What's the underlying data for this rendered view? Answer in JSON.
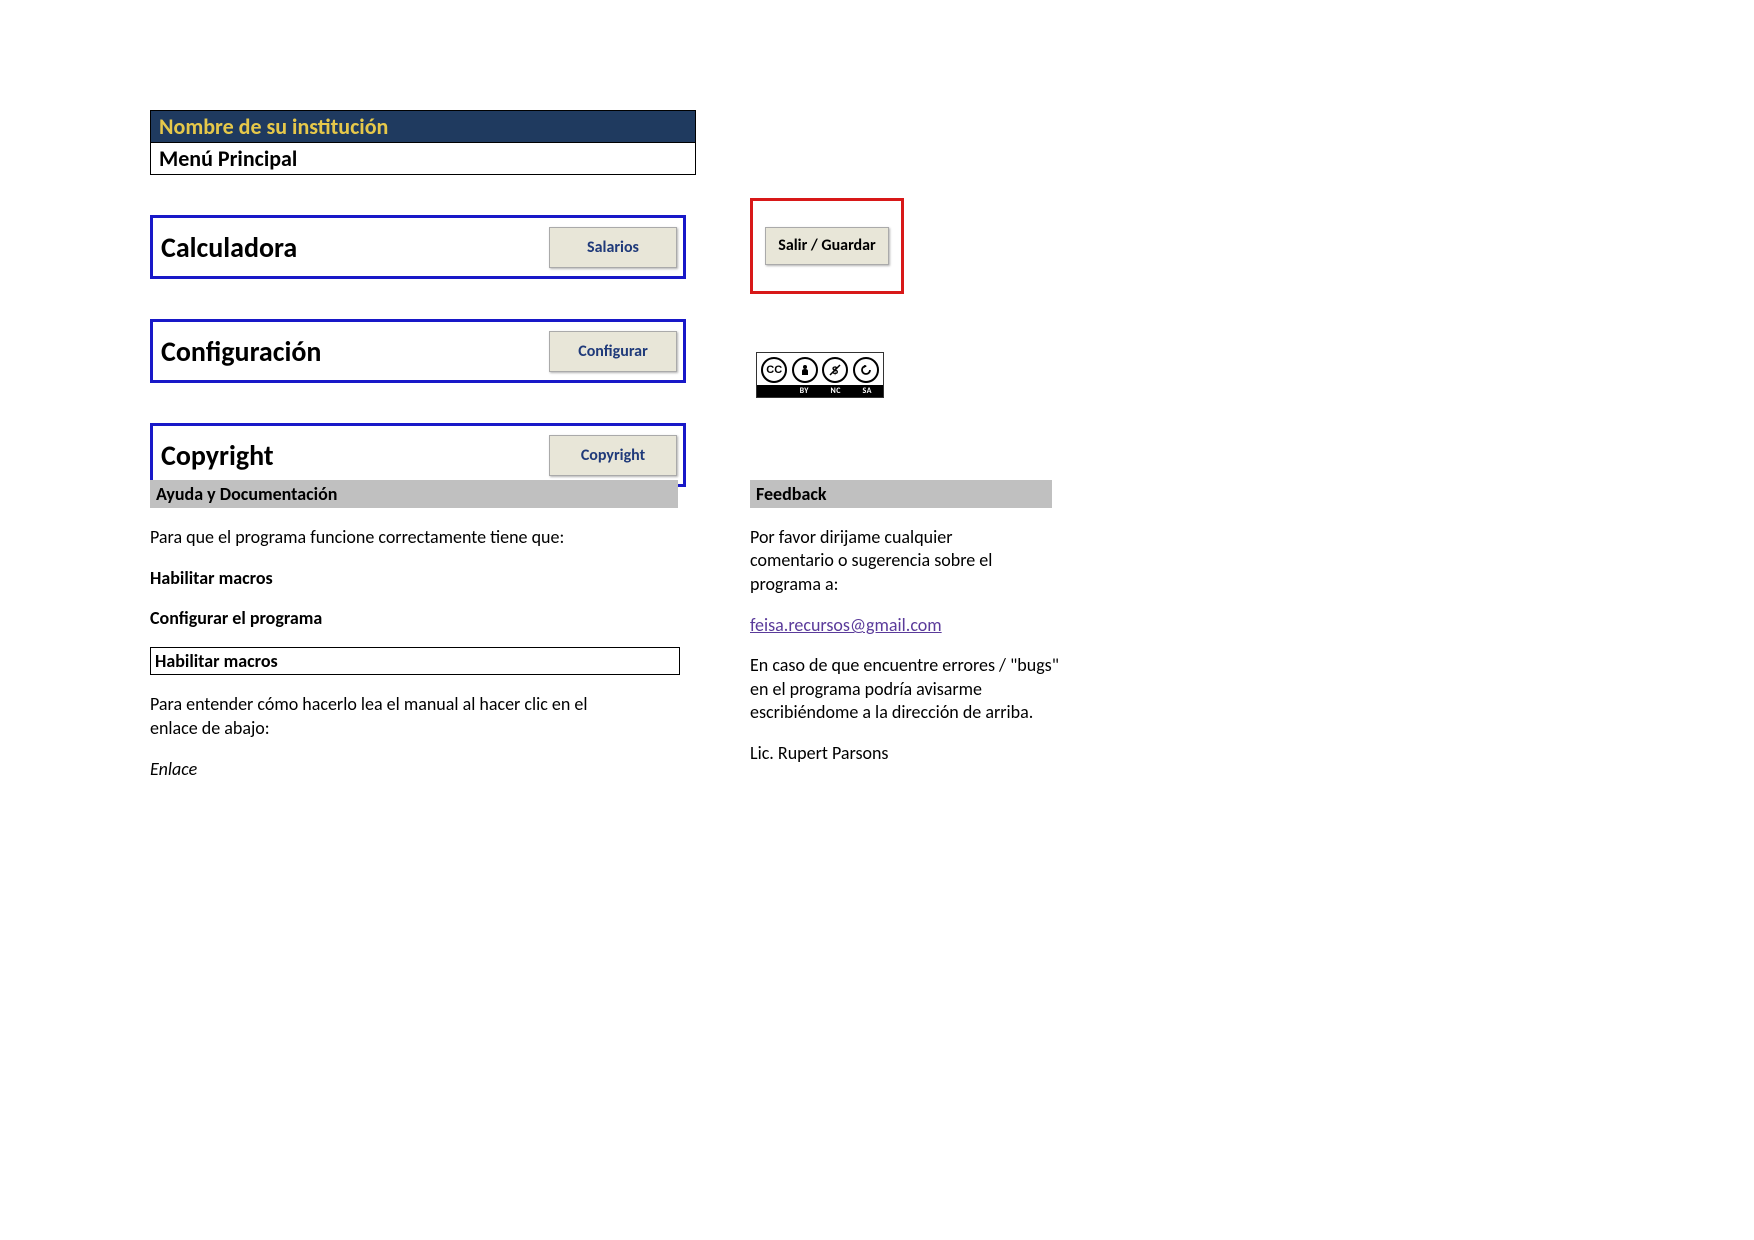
{
  "header": {
    "institution": "Nombre de su institución",
    "menu_title": "Menú Principal"
  },
  "menu": [
    {
      "label": "Calculadora",
      "button": "Salarios"
    },
    {
      "label": "Configuración",
      "button": "Configurar"
    },
    {
      "label": "Copyright",
      "button": "Copyright"
    }
  ],
  "sidebar": {
    "save_exit": "Salir / Guardar"
  },
  "license": {
    "cc_text": "CC",
    "by": "BY",
    "nc": "NC",
    "sa": "SA"
  },
  "help": {
    "header": "Ayuda y Documentación",
    "intro": "Para que el programa funcione correctamente tiene que:",
    "step1": "Habilitar macros",
    "step2": "Configurar el programa",
    "box_title": "Habilitar macros",
    "instruction": "Para entender cómo hacerlo lea el manual al hacer clic en el enlace de abajo:",
    "link_label": "Enlace"
  },
  "feedback": {
    "header": "Feedback",
    "intro": "Por favor dirijame cualquier comentario o sugerencia sobre el programa a:",
    "email": "feisa.recursos@gmail.com",
    "bugs": "En caso de que encuentre errores / \"bugs\" en el programa podría avisarme escribiéndome a la dirección de arriba.",
    "author": "Lic. Rupert Parsons"
  }
}
